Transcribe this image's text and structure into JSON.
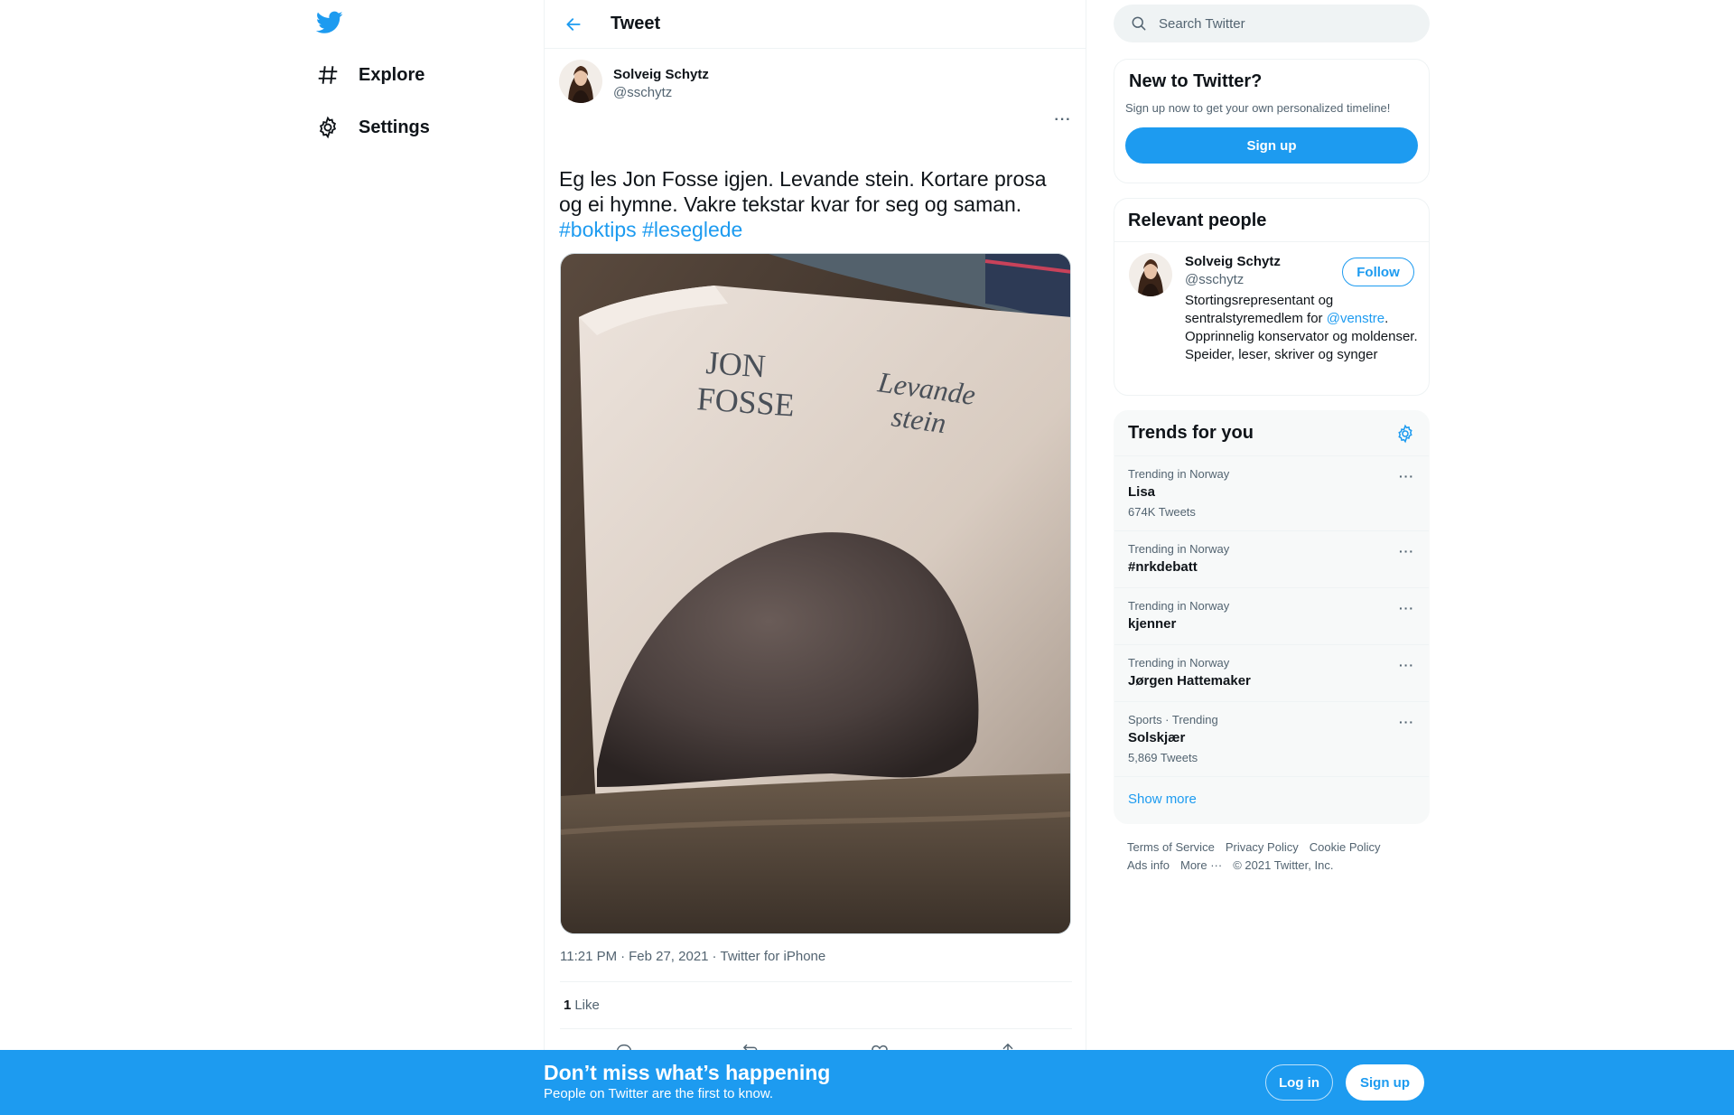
{
  "colors": {
    "accent": "#1d9bf0",
    "text": "#0f1419",
    "muted": "#536471",
    "border": "#eff3f4"
  },
  "nav": {
    "logo": "twitter-bird-icon",
    "items": [
      {
        "label": "Explore",
        "icon": "hashtag-icon"
      },
      {
        "label": "Settings",
        "icon": "gear-icon"
      }
    ]
  },
  "main": {
    "title": "Tweet",
    "tweet": {
      "author_name": "Solveig Schytz",
      "author_handle": "@sschytz",
      "text": "Eg les Jon Fosse igjen. Levande stein. Kortare prosa og ei hymne. Vakre tekstar kvar for seg og saman.",
      "hashtags": [
        "#boktips",
        "#leseglede"
      ],
      "media": {
        "cover_author": [
          "JON",
          "FOSSE"
        ],
        "cover_title": [
          "Levande",
          "stein"
        ]
      },
      "time": "11:21 PM",
      "date": "Feb 27, 2021",
      "source": "Twitter for iPhone",
      "like_count": "1",
      "like_label": "Like"
    }
  },
  "sidebar": {
    "search_placeholder": "Search Twitter",
    "new_to_twitter": {
      "title": "New to Twitter?",
      "subtitle": "Sign up now to get your own personalized timeline!",
      "button": "Sign up"
    },
    "relevant_people": {
      "title": "Relevant people",
      "person": {
        "name": "Solveig Schytz",
        "handle": "@sschytz",
        "follow": "Follow",
        "bio_pre": "Stortingsrepresentant og sentralstyremedlem for ",
        "bio_mention": "@venstre",
        "bio_post": ". Opprinnelig konservator og moldenser. Speider, leser, skriver og synger"
      }
    },
    "trends": {
      "title": "Trends for you",
      "items": [
        {
          "context": "Trending in Norway",
          "name": "Lisa",
          "count": "674K Tweets"
        },
        {
          "context": "Trending in Norway",
          "name": "#nrkdebatt",
          "count": ""
        },
        {
          "context": "Trending in Norway",
          "name": "kjenner",
          "count": ""
        },
        {
          "context": "Trending in Norway",
          "name": "Jørgen Hattemaker",
          "count": ""
        },
        {
          "context": "Sports · Trending",
          "name": "Solskjær",
          "count": "5,869 Tweets"
        }
      ],
      "show_more": "Show more"
    },
    "footer": {
      "links": [
        "Terms of Service",
        "Privacy Policy",
        "Cookie Policy",
        "Ads info",
        "More ···"
      ],
      "copyright": "© 2021 Twitter, Inc."
    }
  },
  "bottom_bar": {
    "title": "Don’t miss what’s happening",
    "subtitle": "People on Twitter are the first to know.",
    "login": "Log in",
    "signup": "Sign up"
  }
}
